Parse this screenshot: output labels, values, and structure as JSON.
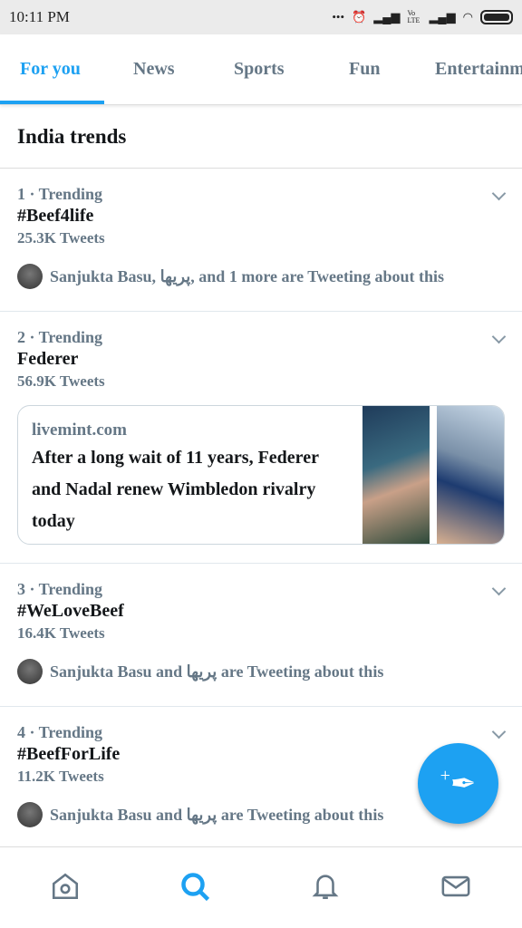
{
  "status": {
    "time": "10:11 PM",
    "icons": [
      "dots-icon",
      "alarm-icon",
      "signal-icon",
      "volte-icon",
      "signal-icon",
      "wifi-icon",
      "battery-icon"
    ],
    "volte": "Vo LTE"
  },
  "tabs": [
    {
      "label": "For you",
      "active": true
    },
    {
      "label": "News"
    },
    {
      "label": "Sports"
    },
    {
      "label": "Fun"
    },
    {
      "label": "Entertainment"
    }
  ],
  "section_title": "India trends",
  "trends": [
    {
      "meta": "1 · Trending",
      "name": "#Beef4life",
      "count": "25.3K Tweets",
      "social": "Sanjukta Basu, پریها, and 1 more are Tweeting about this"
    },
    {
      "meta": "2 · Trending",
      "name": "Federer",
      "count": "56.9K Tweets",
      "card": {
        "source": "livemint.com",
        "headline": "After a long wait of 11 years, Federer and Nadal renew Wimbledon rivalry today"
      }
    },
    {
      "meta": "3 · Trending",
      "name": "#WeLoveBeef",
      "count": "16.4K Tweets",
      "social": "Sanjukta Basu and پریها are Tweeting about this"
    },
    {
      "meta": "4 · Trending",
      "name": "#BeefForLife",
      "count": "11.2K Tweets",
      "social": "Sanjukta Basu and پریها are Tweeting about this"
    }
  ],
  "fab": {
    "icon": "compose-tweet-icon",
    "label": "+"
  },
  "bottom_nav": [
    "home-icon",
    "search-icon",
    "notifications-icon",
    "messages-icon"
  ],
  "colors": {
    "accent": "#1da1f2",
    "muted": "#657786"
  }
}
